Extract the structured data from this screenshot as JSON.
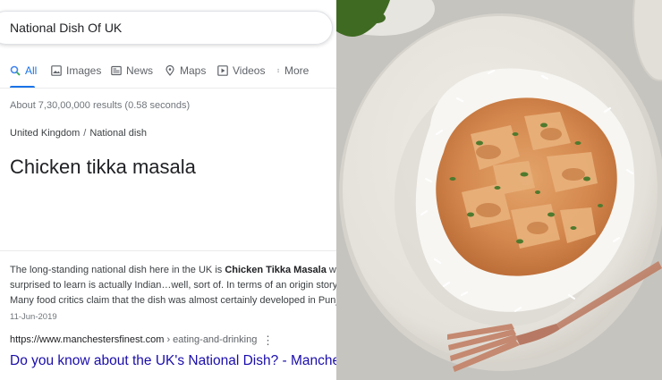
{
  "search": {
    "query": "National Dish Of UK"
  },
  "tabs": [
    {
      "label": "All",
      "icon": "search-icon",
      "active": true
    },
    {
      "label": "Images",
      "icon": "image-icon"
    },
    {
      "label": "News",
      "icon": "news-icon"
    },
    {
      "label": "Maps",
      "icon": "map-pin-icon"
    },
    {
      "label": "Videos",
      "icon": "play-icon"
    },
    {
      "label": "More",
      "icon": "more-vertical-icon"
    }
  ],
  "results_count": "About 7,30,00,000 results (0.58 seconds)",
  "featured": {
    "breadcrumb": [
      "United Kingdom",
      "National dish"
    ],
    "answer": "Chicken tikka masala",
    "snippet_line1_pre": "The long-standing national dish here in the UK is ",
    "snippet_line1_bold": "Chicken Tikka Masala",
    "snippet_line1_post": " wh",
    "snippet_line2": "surprised to learn is actually Indian…well, sort of. In terms of an origin story, t",
    "snippet_line3": "Many food critics claim that the dish was almost certainly developed in Punjab",
    "date": "11-Jun-2019",
    "url_host": "https://www.manchestersfinest.com",
    "url_path": " › eating-and-drinking",
    "more_symbol": "⋮",
    "title": "Do you know about the UK's National Dish? - Manches"
  },
  "colors": {
    "link": "#1a0dab",
    "accent": "#1a73e8",
    "muted": "#70757a"
  }
}
